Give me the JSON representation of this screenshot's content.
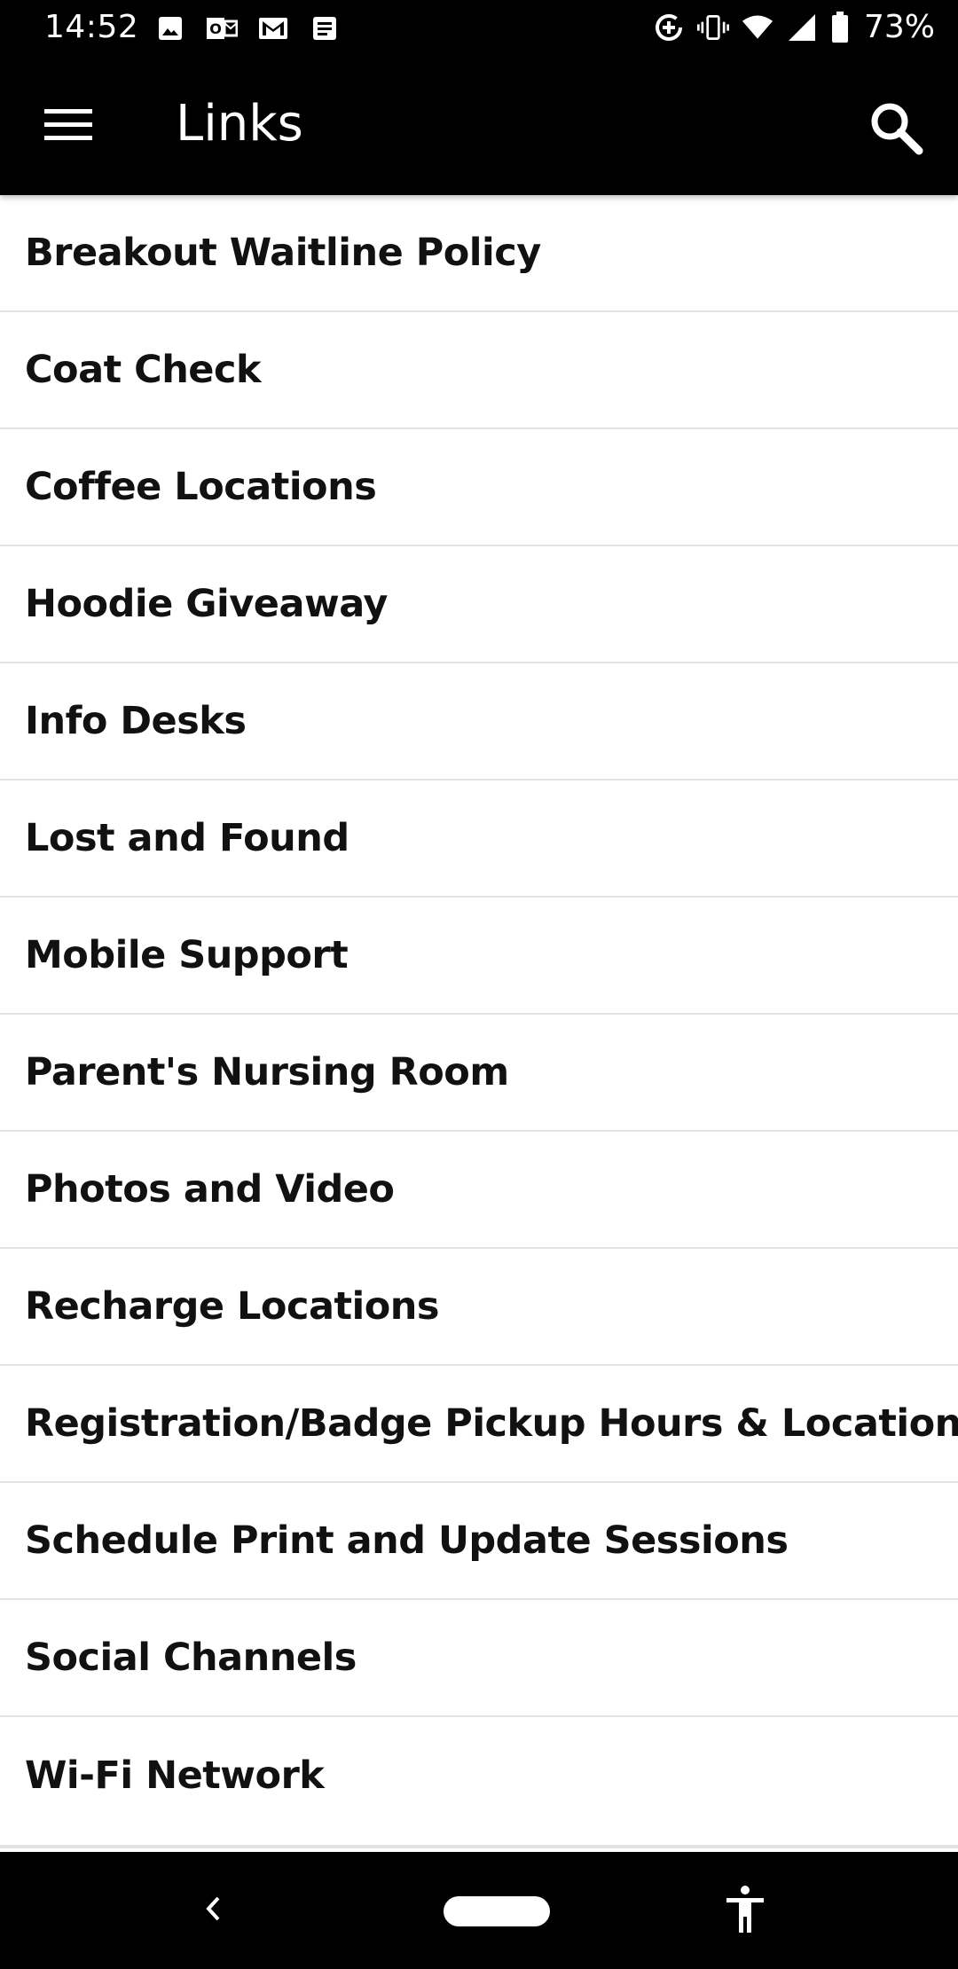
{
  "status_bar": {
    "time": "14:52",
    "left_icons": [
      "image-icon",
      "outlook-icon",
      "gmail-icon",
      "document-icon"
    ],
    "right_icons": [
      "data-saver-icon",
      "vibrate-icon",
      "wifi-icon",
      "signal-icon",
      "battery-icon"
    ],
    "battery_percent": "73%"
  },
  "app_bar": {
    "title": "Links",
    "menu_icon": "hamburger-menu-icon",
    "search_icon": "search-icon",
    "background": "#000000"
  },
  "links": [
    {
      "label": "Breakout Waitline Policy"
    },
    {
      "label": "Coat Check"
    },
    {
      "label": "Coffee Locations"
    },
    {
      "label": "Hoodie Giveaway"
    },
    {
      "label": "Info Desks"
    },
    {
      "label": "Lost and Found"
    },
    {
      "label": "Mobile Support"
    },
    {
      "label": "Parent's Nursing Room"
    },
    {
      "label": "Photos and Video"
    },
    {
      "label": "Recharge Locations"
    },
    {
      "label": "Registration/Badge Pickup Hours & Locations"
    },
    {
      "label": "Schedule Print and Update Sessions"
    },
    {
      "label": "Social Channels"
    },
    {
      "label": "Wi-Fi Network"
    }
  ],
  "nav_bar": {
    "back_icon": "back-chevron-icon",
    "home_icon": "home-pill-icon",
    "accessibility_icon": "accessibility-icon"
  }
}
